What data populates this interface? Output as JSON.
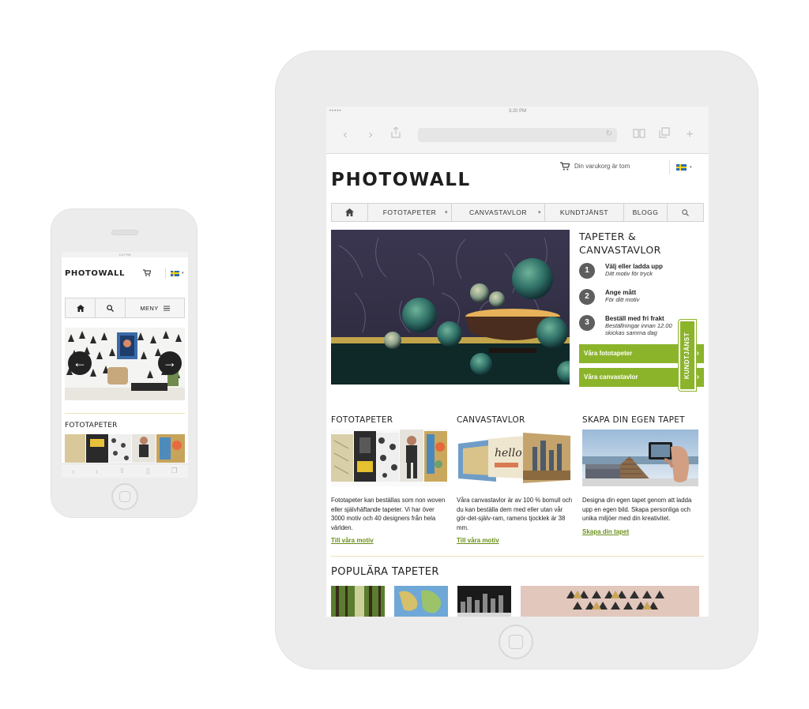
{
  "phone": {
    "status_time": "4:47 PM",
    "logo": "PHOTOWALL",
    "menu_label": "MENY",
    "arrow_prev": "←",
    "arrow_next": "→",
    "section_title": "FOTOTAPETER"
  },
  "tablet": {
    "status_time": "3:20 PM",
    "logo": "PHOTOWALL",
    "cart_text": "Din varukorg är tom",
    "nav": {
      "items": [
        "FOTOTAPETER",
        "CANVASTAVLOR",
        "KUNDTJÄNST",
        "BLOGG"
      ]
    },
    "hero": {
      "title_line1": "TAPETER &",
      "title_line2": "CANVASTAVLOR",
      "steps": [
        {
          "num": "1",
          "title": "Välj eller ladda upp",
          "sub": "Ditt motiv för tryck"
        },
        {
          "num": "2",
          "title": "Ange mått",
          "sub": "För ditt motiv"
        },
        {
          "num": "3",
          "title": "Beställ med fri frakt",
          "sub": "Beställningar innan 12.00 skickas samma dag"
        }
      ],
      "buttons": [
        "Våra fototapeter",
        "Våra canvastavlor"
      ]
    },
    "kundtjanst_tab": "KUNDTJÄNST",
    "columns": [
      {
        "title": "FOTOTAPETER",
        "text": "Fototapeter kan beställas som non woven eller självhäftande tapeter. Vi har över 3000 motiv och 40 designers från hela världen.",
        "link": "Till våra motiv",
        "hello_text": ""
      },
      {
        "title": "CANVASTAVLOR",
        "text": "Våra canvastavlor är av 100 % bomull och du kan beställa dem med eller utan vår gör-det-själv-ram, ramens tjocklek är 38 mm.",
        "link": "Till våra motiv",
        "hello_text": "hello"
      },
      {
        "title": "SKAPA DIN EGEN TAPET",
        "text": "Designa din egen tapet genom att ladda upp en egen bild. Skapa personliga och unika miljöer med din kreativitet.",
        "link": "Skapa din tapet",
        "hello_text": ""
      }
    ],
    "popular_title": "POPULÄRA TAPETER"
  },
  "colors": {
    "accent_green": "#8cb42b",
    "link_green": "#6a8f19",
    "device_frame": "#ececec",
    "divider": "#eee1b8"
  },
  "icons": [
    "home-icon",
    "cart-icon",
    "search-icon",
    "menu-icon",
    "swedish-flag-icon",
    "arrow-left-icon",
    "arrow-right-icon"
  ]
}
